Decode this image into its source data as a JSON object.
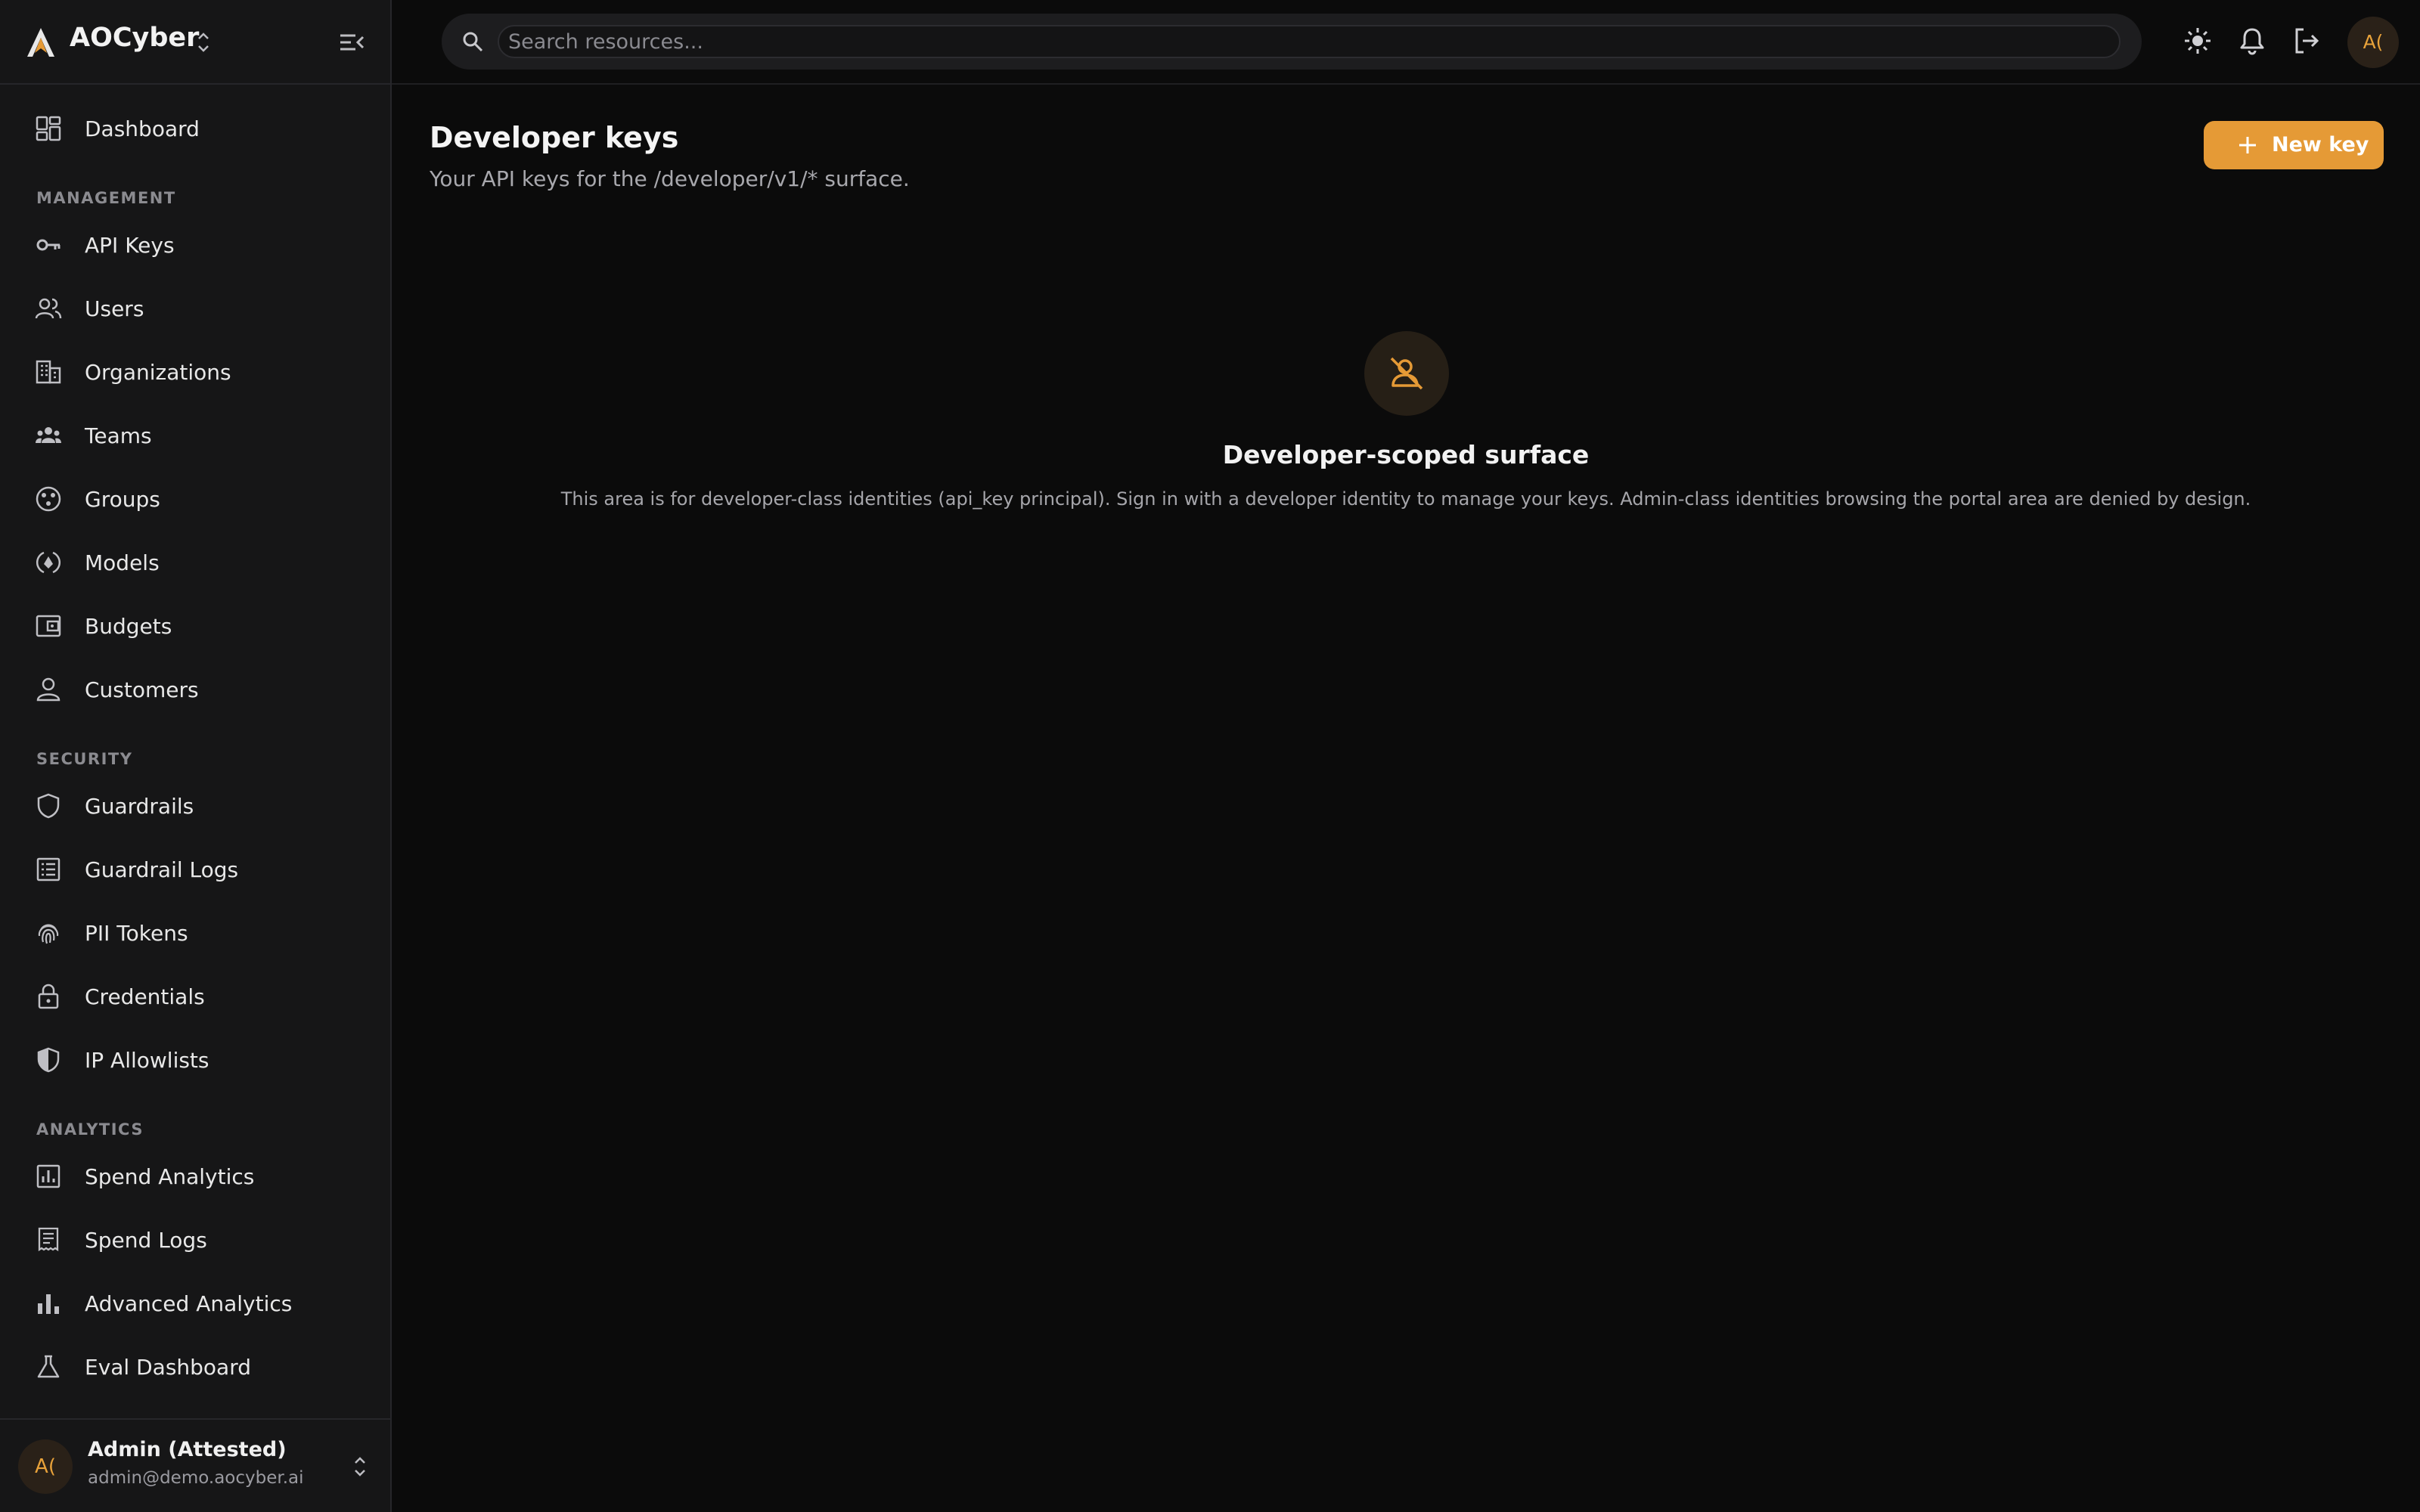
{
  "brand": {
    "name": "AOCyber",
    "accent": "#e59a36"
  },
  "search": {
    "placeholder": "Search resources..."
  },
  "topbar": {
    "icons": [
      "sun-icon",
      "bell-icon",
      "logout-icon"
    ],
    "avatar_initials": "A("
  },
  "sidebar": {
    "dashboard": "Dashboard",
    "sections": {
      "management": "MANAGEMENT",
      "security": "SECURITY",
      "analytics": "ANALYTICS"
    },
    "management_items": [
      "API Keys",
      "Users",
      "Organizations",
      "Teams",
      "Groups",
      "Models",
      "Budgets",
      "Customers"
    ],
    "security_items": [
      "Guardrails",
      "Guardrail Logs",
      "PII Tokens",
      "Credentials",
      "IP Allowlists"
    ],
    "analytics_items": [
      "Spend Analytics",
      "Spend Logs",
      "Advanced Analytics",
      "Eval Dashboard"
    ]
  },
  "user": {
    "initials": "A(",
    "name": "Admin (Attested)",
    "email": "admin@demo.aocyber.ai"
  },
  "main": {
    "title": "Developer keys",
    "subtitle": "Your API keys for the /developer/v1/* surface.",
    "new_key_label": "New key",
    "empty": {
      "icon": "user-off-icon",
      "title": "Developer-scoped surface",
      "description": "This area is for developer-class identities (api_key principal). Sign in with a developer identity to manage your keys. Admin-class identities browsing the portal area are denied by design."
    }
  }
}
